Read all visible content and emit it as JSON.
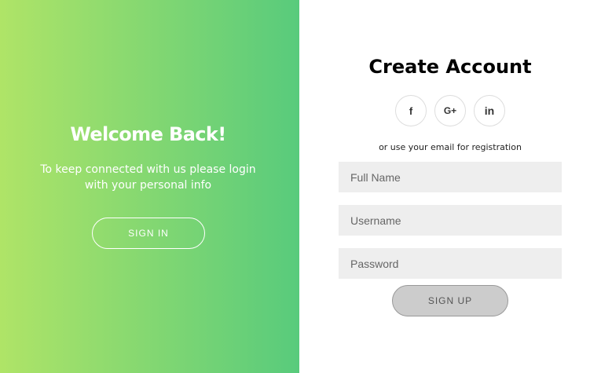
{
  "colors": {
    "gradient_start": "#afe467",
    "gradient_end": "#58cb7c",
    "field_background": "#eeeeee",
    "signup_button_background": "#cccccc"
  },
  "welcome_panel": {
    "title": "Welcome Back!",
    "text": "To keep connected with us please login with your personal info",
    "signin_label": "SIGN IN"
  },
  "signup_panel": {
    "title": "Create Account",
    "social": [
      {
        "name": "facebook-icon",
        "glyph": "f"
      },
      {
        "name": "google-plus-icon",
        "glyph": "G+"
      },
      {
        "name": "linkedin-icon",
        "glyph": "in"
      }
    ],
    "email_note": "or use your email for registration",
    "fields": {
      "full_name_placeholder": "Full Name",
      "username_placeholder": "Username",
      "password_placeholder": "Password"
    },
    "signup_label": "SIGN UP"
  }
}
